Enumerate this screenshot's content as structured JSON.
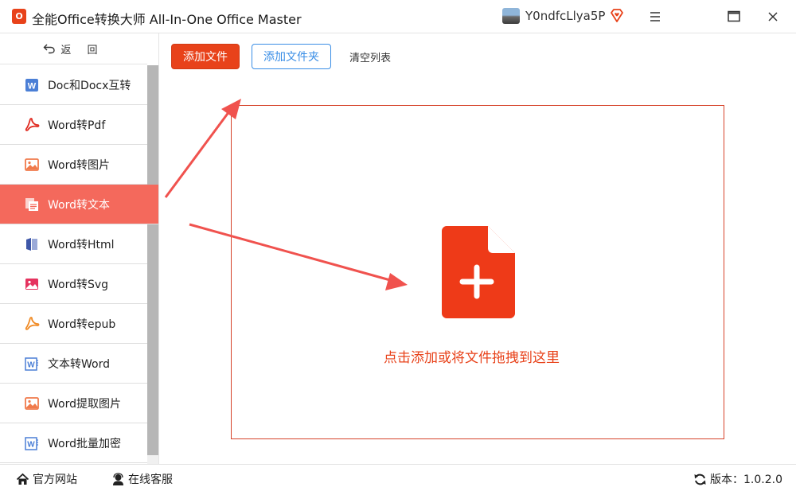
{
  "app": {
    "logo_text": "O",
    "title": "全能Office转换大师 All-In-One Office Master",
    "username": "Y0ndfcLlya5P"
  },
  "icons": {
    "vip": "diamond-heart-icon",
    "menu": "hamburger-menu-icon",
    "maximize": "maximize-icon",
    "close": "close-icon"
  },
  "sidebar": {
    "back_label": "返 回",
    "active_index": 3,
    "items": [
      {
        "label": "Doc和Docx互转",
        "icon": "word-doc-icon"
      },
      {
        "label": "Word转Pdf",
        "icon": "pdf-icon"
      },
      {
        "label": "Word转图片",
        "icon": "image-icon"
      },
      {
        "label": "Word转文本",
        "icon": "text-file-icon"
      },
      {
        "label": "Word转Html",
        "icon": "html-book-icon"
      },
      {
        "label": "Word转Svg",
        "icon": "svg-image-icon"
      },
      {
        "label": "Word转epub",
        "icon": "epub-icon"
      },
      {
        "label": "文本转Word",
        "icon": "word-outline-icon"
      },
      {
        "label": "Word提取图片",
        "icon": "image-icon"
      },
      {
        "label": "Word批量加密",
        "icon": "word-outline-icon"
      }
    ]
  },
  "toolbar": {
    "add_file": "添加文件",
    "add_folder": "添加文件夹",
    "clear_list": "清空列表"
  },
  "dropzone": {
    "hint": "点击添加或将文件拖拽到这里"
  },
  "footer": {
    "official_site": "官方网站",
    "online_service": "在线客服",
    "version": "版本：1.0.2.0"
  },
  "colors": {
    "accent": "#e8421a",
    "active_nav": "#f4695c",
    "blue": "#3a8ee6",
    "arrow": "#f0524e"
  }
}
